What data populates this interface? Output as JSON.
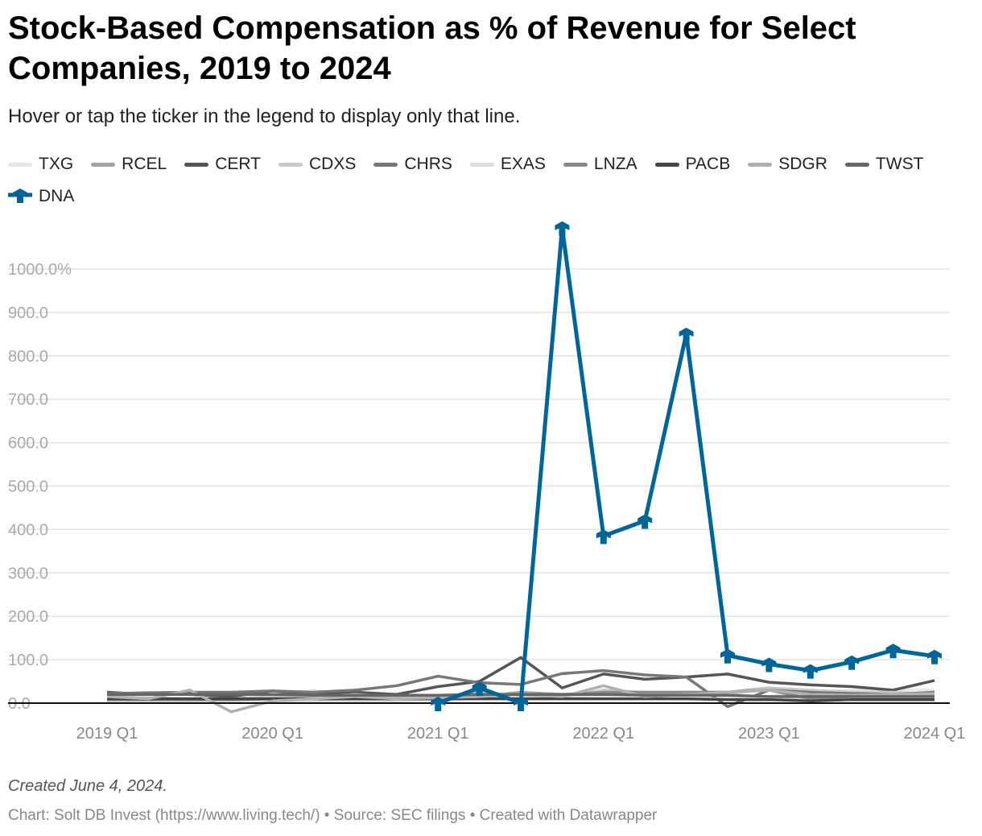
{
  "title": "Stock-Based Compensation as % of Revenue for Select Companies, 2019 to 2024",
  "subtitle": "Hover or tap the ticker in the legend to display only that line.",
  "footer": {
    "created": "Created June 4, 2024.",
    "source": "Chart: Solt DB Invest (https://www.living.tech/) • Source: SEC filings • Created with Datawrapper"
  },
  "chart_data": {
    "type": "line",
    "title": "Stock-Based Compensation as % of Revenue for Select Companies, 2019 to 2024",
    "xlabel": "",
    "ylabel": "",
    "ylim": [
      -30,
      1100
    ],
    "y_ticks": [
      0,
      100,
      200,
      300,
      400,
      500,
      600,
      700,
      800,
      900,
      1000
    ],
    "y_tick_labels": [
      "0.0",
      "100.0",
      "200.0",
      "300.0",
      "400.0",
      "500.0",
      "600.0",
      "700.0",
      "800.0",
      "900.0",
      "1000.0%"
    ],
    "x": [
      "2019 Q1",
      "2019 Q2",
      "2019 Q3",
      "2019 Q4",
      "2020 Q1",
      "2020 Q2",
      "2020 Q3",
      "2020 Q4",
      "2021 Q1",
      "2021 Q2",
      "2021 Q3",
      "2021 Q4",
      "2022 Q1",
      "2022 Q2",
      "2022 Q3",
      "2022 Q4",
      "2023 Q1",
      "2023 Q2",
      "2023 Q3",
      "2023 Q4",
      "2024 Q1"
    ],
    "x_tick_labels": [
      "2019 Q1",
      "2020 Q1",
      "2021 Q1",
      "2022 Q1",
      "2023 Q1",
      "2024 Q1"
    ],
    "grid": true,
    "legend": "top",
    "series": [
      {
        "name": "TXG",
        "color": "#e6e6e6",
        "values": [
          5,
          5,
          10,
          8,
          10,
          30,
          15,
          10,
          12,
          10,
          12,
          15,
          18,
          20,
          20,
          15,
          15,
          25,
          30,
          30,
          30
        ]
      },
      {
        "name": "RCEL",
        "color": "#a3a3a3",
        "values": [
          10,
          10,
          10,
          10,
          10,
          12,
          12,
          12,
          15,
          15,
          25,
          20,
          20,
          25,
          25,
          25,
          35,
          20,
          20,
          18,
          25
        ]
      },
      {
        "name": "CERT",
        "color": "#555555",
        "values": [
          25,
          20,
          20,
          15,
          28,
          20,
          25,
          20,
          38,
          50,
          105,
          35,
          67,
          55,
          60,
          67,
          48,
          42,
          38,
          30,
          52
        ]
      },
      {
        "name": "CDXS",
        "color": "#c8c8c8",
        "values": [
          15,
          12,
          10,
          10,
          15,
          15,
          20,
          15,
          15,
          25,
          18,
          15,
          30,
          25,
          25,
          20,
          35,
          30,
          25,
          25,
          20
        ]
      },
      {
        "name": "CHRS",
        "color": "#777777",
        "values": [
          22,
          24,
          25,
          25,
          28,
          25,
          30,
          40,
          62,
          47,
          43,
          68,
          75,
          65,
          60,
          -8,
          30,
          25,
          22,
          20,
          25
        ]
      },
      {
        "name": "EXAS",
        "color": "#dddddd",
        "values": [
          5,
          5,
          5,
          5,
          5,
          5,
          5,
          5,
          8,
          10,
          10,
          10,
          10,
          10,
          10,
          10,
          12,
          12,
          12,
          12,
          12
        ]
      },
      {
        "name": "LNZA",
        "color": "#8a8a8a",
        "values": [
          8,
          8,
          8,
          8,
          10,
          10,
          10,
          10,
          10,
          15,
          20,
          20,
          25,
          25,
          25,
          25,
          30,
          10,
          15,
          15,
          15
        ]
      },
      {
        "name": "PACB",
        "color": "#444444",
        "values": [
          10,
          10,
          10,
          10,
          10,
          10,
          10,
          10,
          10,
          10,
          10,
          10,
          10,
          10,
          10,
          8,
          8,
          5,
          8,
          8,
          8
        ]
      },
      {
        "name": "SDGR",
        "color": "#b0b0b0",
        "values": [
          15,
          10,
          30,
          -20,
          5,
          10,
          15,
          10,
          12,
          15,
          20,
          15,
          40,
          15,
          20,
          25,
          30,
          20,
          18,
          20,
          22
        ]
      },
      {
        "name": "TWST",
        "color": "#666666",
        "values": [
          20,
          20,
          20,
          20,
          20,
          18,
          18,
          18,
          18,
          20,
          20,
          20,
          20,
          18,
          18,
          18,
          15,
          15,
          15,
          15,
          15
        ]
      },
      {
        "name": "DNA",
        "color": "#006699",
        "values": [
          null,
          null,
          null,
          null,
          null,
          null,
          null,
          null,
          0,
          35,
          0,
          1095,
          385,
          420,
          850,
          110,
          90,
          75,
          95,
          122,
          108
        ]
      }
    ]
  }
}
